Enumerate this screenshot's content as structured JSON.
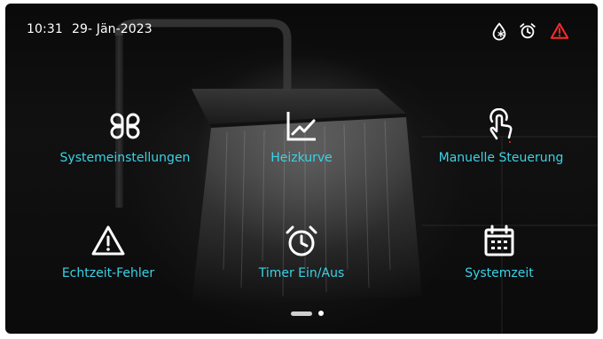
{
  "status_bar": {
    "time": "10:31",
    "date": "29- Jän-2023",
    "icons": [
      "defrost-icon",
      "alarm-clock-icon",
      "warning-icon"
    ],
    "warning_color": "#ff2b2b"
  },
  "accent_color": "#39d3e8",
  "menu": {
    "tiles": [
      {
        "label": "Systemeinstellungen",
        "icon": "grid-icon"
      },
      {
        "label": "Heizkurve",
        "icon": "chart-curve-icon"
      },
      {
        "label": "Manuelle Steuerung",
        "icon": "touch-icon"
      },
      {
        "label": "Echtzeit-Fehler",
        "icon": "warning-triangle-icon"
      },
      {
        "label": "Timer Ein/Aus",
        "icon": "alarm-clock-icon"
      },
      {
        "label": "Systemzeit",
        "icon": "calendar-icon"
      }
    ]
  },
  "pagination": {
    "current": 1,
    "total": 2
  }
}
